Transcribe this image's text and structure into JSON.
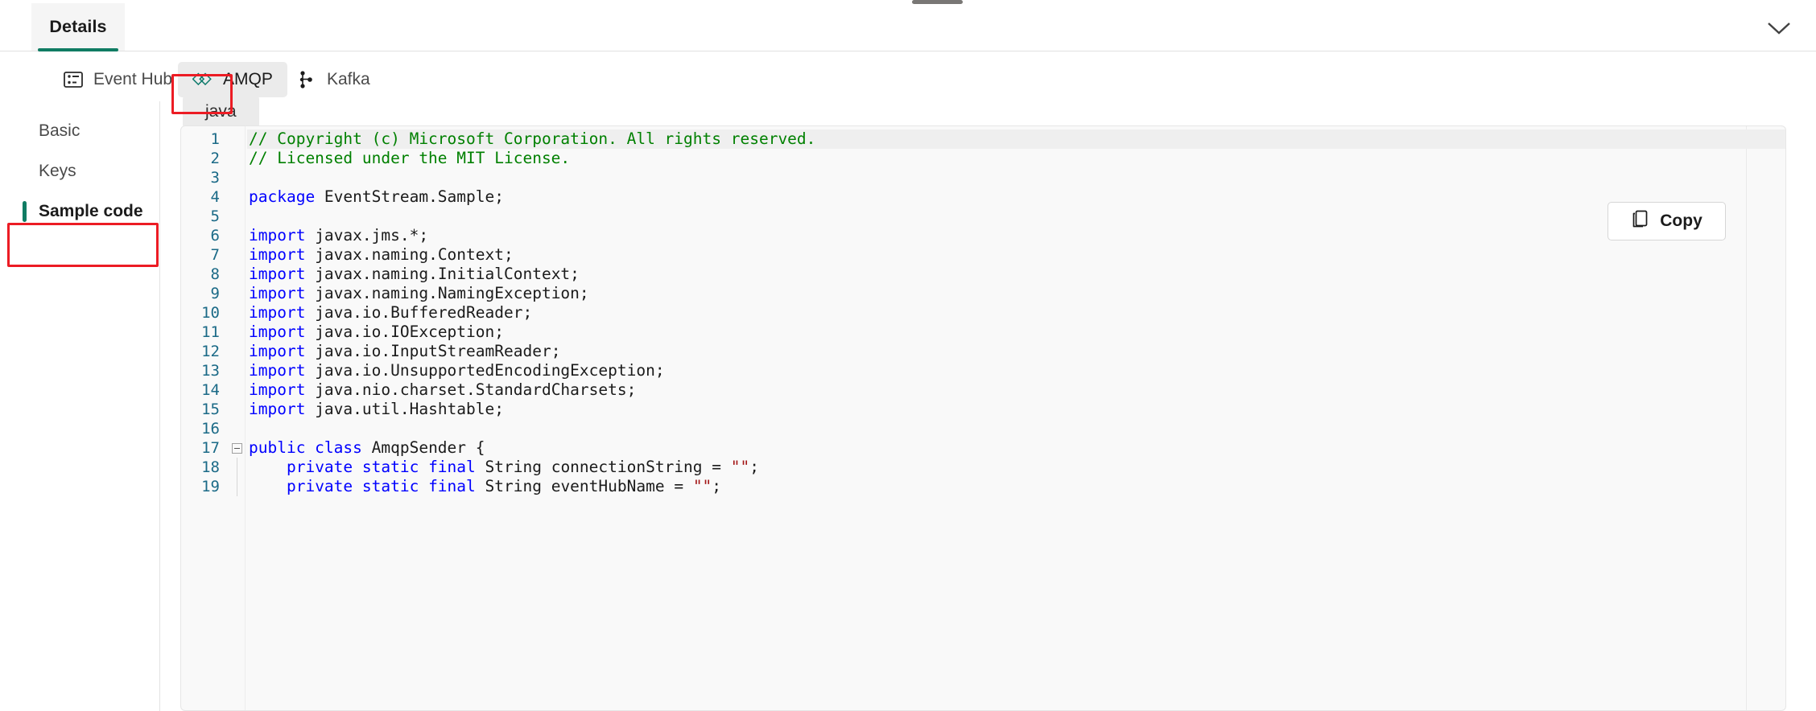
{
  "window": {
    "top_tab": "Details",
    "collapse_icon": "chevron-down-icon"
  },
  "protocol_pivots": [
    {
      "label": "Event Hub",
      "icon": "event-hub-icon",
      "selected": false
    },
    {
      "label": "AMQP",
      "icon": "amqp-link-icon",
      "selected": true
    },
    {
      "label": "Kafka",
      "icon": "kafka-nodes-icon",
      "selected": false
    }
  ],
  "sidebar": {
    "items": [
      {
        "label": "Basic",
        "selected": false
      },
      {
        "label": "Keys",
        "selected": false
      },
      {
        "label": "Sample code",
        "selected": true
      }
    ]
  },
  "language_tabs": [
    {
      "label": "java",
      "selected": true
    }
  ],
  "copy_button": {
    "label": "Copy",
    "icon": "copy-icon"
  },
  "annotations": [
    {
      "target": "AMQP",
      "color": "#ec1c24"
    },
    {
      "target": "Sample code",
      "color": "#ec1c24"
    }
  ],
  "colors": {
    "accent_green": "#107c63",
    "pivot_selected_bg": "#ebebeb",
    "annotation_red": "#ec1c24",
    "code_bg": "#f9f9f9",
    "comment": "#008000",
    "keyword": "#0000ff",
    "string": "#a31515",
    "line_number": "#1b6a87"
  },
  "code": {
    "language": "java",
    "lines": [
      {
        "n": 1,
        "fold": "none",
        "guide": false,
        "highlight": true,
        "tokens": [
          {
            "t": "// Copyright (c) Microsoft Corporation. All rights reserved.",
            "c": "cmt"
          }
        ]
      },
      {
        "n": 2,
        "fold": "none",
        "guide": false,
        "highlight": false,
        "tokens": [
          {
            "t": "// Licensed under the MIT License.",
            "c": "cmt"
          }
        ]
      },
      {
        "n": 3,
        "fold": "none",
        "guide": false,
        "highlight": false,
        "tokens": []
      },
      {
        "n": 4,
        "fold": "none",
        "guide": false,
        "highlight": false,
        "tokens": [
          {
            "t": "package",
            "c": "kw"
          },
          {
            "t": " EventStream.Sample;",
            "c": "pln"
          }
        ]
      },
      {
        "n": 5,
        "fold": "none",
        "guide": false,
        "highlight": false,
        "tokens": []
      },
      {
        "n": 6,
        "fold": "none",
        "guide": false,
        "highlight": false,
        "tokens": [
          {
            "t": "import",
            "c": "kw"
          },
          {
            "t": " javax.jms.*;",
            "c": "pln"
          }
        ]
      },
      {
        "n": 7,
        "fold": "none",
        "guide": false,
        "highlight": false,
        "tokens": [
          {
            "t": "import",
            "c": "kw"
          },
          {
            "t": " javax.naming.Context;",
            "c": "pln"
          }
        ]
      },
      {
        "n": 8,
        "fold": "none",
        "guide": false,
        "highlight": false,
        "tokens": [
          {
            "t": "import",
            "c": "kw"
          },
          {
            "t": " javax.naming.InitialContext;",
            "c": "pln"
          }
        ]
      },
      {
        "n": 9,
        "fold": "none",
        "guide": false,
        "highlight": false,
        "tokens": [
          {
            "t": "import",
            "c": "kw"
          },
          {
            "t": " javax.naming.NamingException;",
            "c": "pln"
          }
        ]
      },
      {
        "n": 10,
        "fold": "none",
        "guide": false,
        "highlight": false,
        "tokens": [
          {
            "t": "import",
            "c": "kw"
          },
          {
            "t": " java.io.BufferedReader;",
            "c": "pln"
          }
        ]
      },
      {
        "n": 11,
        "fold": "none",
        "guide": false,
        "highlight": false,
        "tokens": [
          {
            "t": "import",
            "c": "kw"
          },
          {
            "t": " java.io.IOException;",
            "c": "pln"
          }
        ]
      },
      {
        "n": 12,
        "fold": "none",
        "guide": false,
        "highlight": false,
        "tokens": [
          {
            "t": "import",
            "c": "kw"
          },
          {
            "t": " java.io.InputStreamReader;",
            "c": "pln"
          }
        ]
      },
      {
        "n": 13,
        "fold": "none",
        "guide": false,
        "highlight": false,
        "tokens": [
          {
            "t": "import",
            "c": "kw"
          },
          {
            "t": " java.io.UnsupportedEncodingException;",
            "c": "pln"
          }
        ]
      },
      {
        "n": 14,
        "fold": "none",
        "guide": false,
        "highlight": false,
        "tokens": [
          {
            "t": "import",
            "c": "kw"
          },
          {
            "t": " java.nio.charset.StandardCharsets;",
            "c": "pln"
          }
        ]
      },
      {
        "n": 15,
        "fold": "none",
        "guide": false,
        "highlight": false,
        "tokens": [
          {
            "t": "import",
            "c": "kw"
          },
          {
            "t": " java.util.Hashtable;",
            "c": "pln"
          }
        ]
      },
      {
        "n": 16,
        "fold": "none",
        "guide": false,
        "highlight": false,
        "tokens": []
      },
      {
        "n": 17,
        "fold": "collapse",
        "guide": false,
        "highlight": false,
        "tokens": [
          {
            "t": "public class",
            "c": "kw"
          },
          {
            "t": " AmqpSender {",
            "c": "pln"
          }
        ]
      },
      {
        "n": 18,
        "fold": "none",
        "guide": true,
        "highlight": false,
        "tokens": [
          {
            "t": "    ",
            "c": "pln"
          },
          {
            "t": "private static final",
            "c": "kw"
          },
          {
            "t": " String connectionString = ",
            "c": "pln"
          },
          {
            "t": "\"\"",
            "c": "str"
          },
          {
            "t": ";",
            "c": "pln"
          }
        ]
      },
      {
        "n": 19,
        "fold": "none",
        "guide": true,
        "highlight": false,
        "tokens": [
          {
            "t": "    ",
            "c": "pln"
          },
          {
            "t": "private static final",
            "c": "kw"
          },
          {
            "t": " String eventHubName = ",
            "c": "pln"
          },
          {
            "t": "\"\"",
            "c": "str"
          },
          {
            "t": ";",
            "c": "pln"
          }
        ]
      }
    ]
  }
}
